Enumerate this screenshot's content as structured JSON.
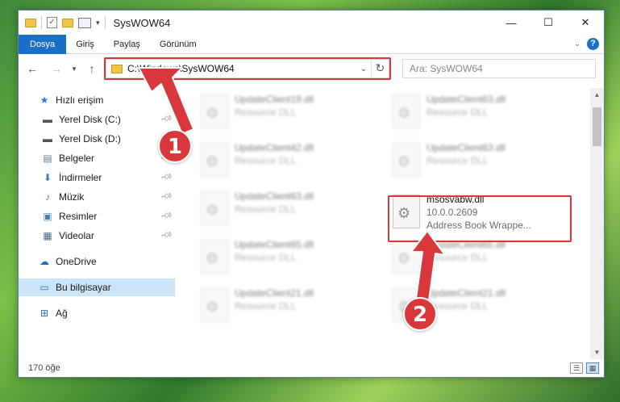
{
  "window": {
    "title": "SysWOW64",
    "controls": {
      "minimize": "—",
      "maximize": "☐",
      "close": "✕"
    }
  },
  "ribbon": {
    "tabs": [
      "Dosya",
      "Giriş",
      "Paylaş",
      "Görünüm"
    ],
    "active_tab": "Dosya",
    "help": "?"
  },
  "navigation": {
    "address": "C:\\Windows\\SysWOW64",
    "search_placeholder": "Ara: SysWOW64"
  },
  "sidebar": {
    "items": [
      {
        "label": "Hızlı erişim",
        "icon": "star-icon",
        "pinned": false
      },
      {
        "label": "Yerel Disk (C:)",
        "icon": "drive-icon",
        "pinned": true
      },
      {
        "label": "Yerel Disk (D:)",
        "icon": "drive-icon",
        "pinned": true
      },
      {
        "label": "Belgeler",
        "icon": "documents-icon",
        "pinned": true
      },
      {
        "label": "İndirmeler",
        "icon": "download-icon",
        "pinned": true
      },
      {
        "label": "Müzik",
        "icon": "music-icon",
        "pinned": true
      },
      {
        "label": "Resimler",
        "icon": "pictures-icon",
        "pinned": true
      },
      {
        "label": "Videolar",
        "icon": "video-icon",
        "pinned": true
      },
      {
        "label": "OneDrive",
        "icon": "cloud-icon",
        "pinned": false
      },
      {
        "label": "Bu bilgisayar",
        "icon": "computer-icon",
        "pinned": false,
        "selected": true
      },
      {
        "label": "Ağ",
        "icon": "network-icon",
        "pinned": false
      }
    ]
  },
  "files": [
    {
      "name": "UpdateClient19.dll",
      "sub": "Resource DLL",
      "blurred": true
    },
    {
      "name": "UpdateClient63.dll",
      "sub": "Resource DLL",
      "blurred": true
    },
    {
      "name": "UpdateClient42.dll",
      "sub": "Resource DLL",
      "blurred": true
    },
    {
      "name": "UpdateClient63.dll",
      "sub": "Resource DLL",
      "blurred": true
    },
    {
      "name": "UpdateClient63.dll",
      "sub": "Resource DLL",
      "blurred": true
    },
    {
      "name": "msosvabw.dll",
      "version": "10.0.0.2609",
      "sub": "Address Book Wrappe...",
      "blurred": false
    },
    {
      "name": "UpdateClient65.dll",
      "sub": "Resource DLL",
      "blurred": true
    },
    {
      "name": "UpdateClient65.dll",
      "sub": "Resource DLL",
      "blurred": true
    },
    {
      "name": "UpdateClient21.dll",
      "sub": "Resource DLL",
      "blurred": true
    },
    {
      "name": "UpdateClient21.dll",
      "sub": "Resource DLL",
      "blurred": true
    }
  ],
  "status": {
    "item_count": "170 öğe"
  },
  "annotations": {
    "step1": "1",
    "step2": "2",
    "color": "#d8373b"
  }
}
